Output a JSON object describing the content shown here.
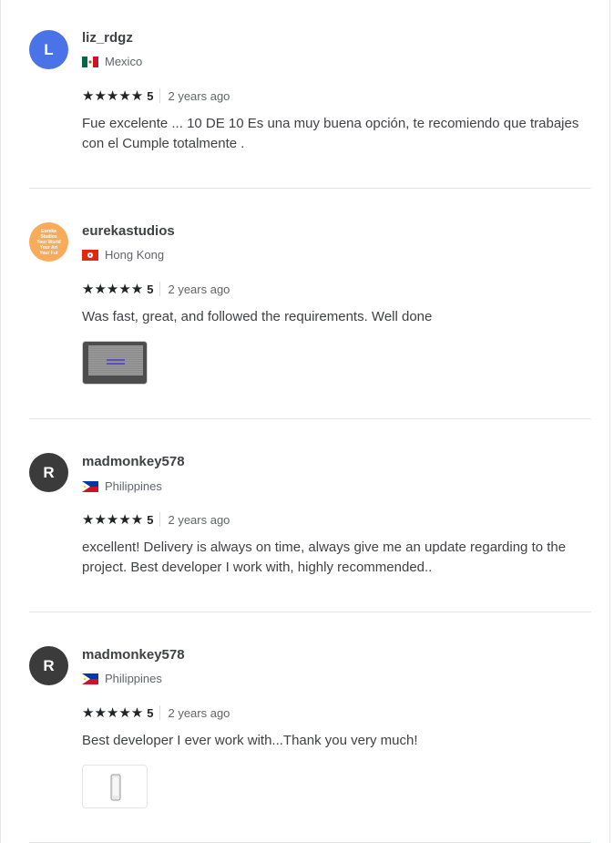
{
  "reviews": [
    {
      "avatar_letter": "L",
      "username": "liz_rdgz",
      "country": "Mexico",
      "stars": "★★★★★",
      "score": "5",
      "time": "2 years ago",
      "text": "Fue excelente ... 10 DE 10 Es una muy buena opción, te recomiendo que trabajes con el Cumple totalmente ."
    },
    {
      "avatar_text": [
        "Eureka",
        "Studios",
        "Your World",
        "Your Art",
        "Your Fut"
      ],
      "username": "eurekastudios",
      "country": "Hong Kong",
      "stars": "★★★★★",
      "score": "5",
      "time": "2 years ago",
      "text": "Was fast, great, and followed the requirements. Well done"
    },
    {
      "avatar_letter": "R",
      "username": "madmonkey578",
      "country": "Philippines",
      "stars": "★★★★★",
      "score": "5",
      "time": "2 years ago",
      "text": "excellent! Delivery is always on time, always give me an update regarding to the project. Best developer I work with, highly recommended.."
    },
    {
      "avatar_letter": "R",
      "username": "madmonkey578",
      "country": "Philippines",
      "stars": "★★★★★",
      "score": "5",
      "time": "2 years ago",
      "text": "Best developer I ever work with...Thank you very much!"
    }
  ],
  "colors": {
    "text": "#404145",
    "muted": "#62646a",
    "divider": "#e4e5e7",
    "avatar_blue": "#4a73e8",
    "avatar_dark": "#3b3b3b",
    "avatar_orange": "#f7ab5b"
  }
}
